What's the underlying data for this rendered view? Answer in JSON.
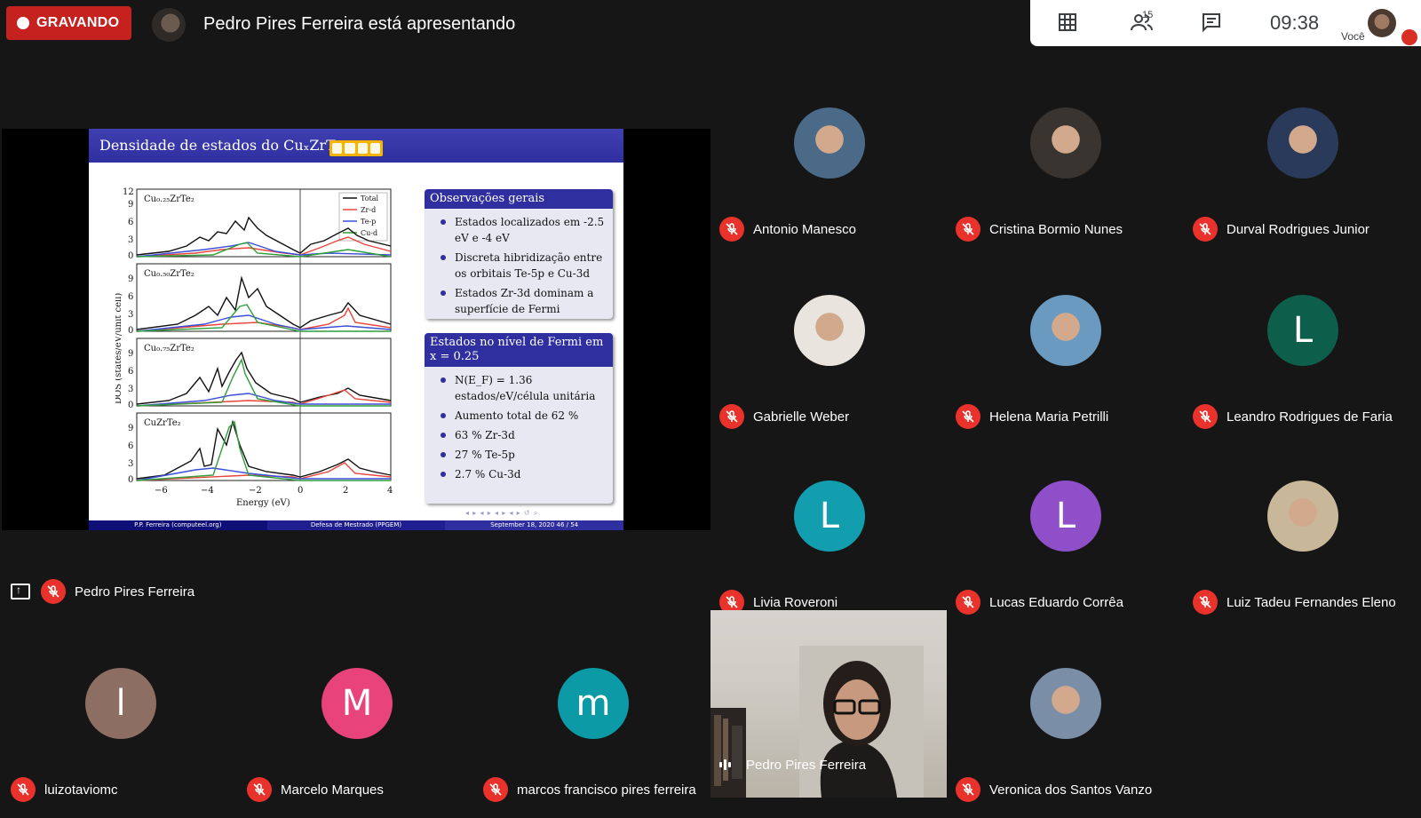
{
  "top": {
    "recording_label": "GRAVANDO",
    "presenting_text": "Pedro Pires Ferreira está apresentando",
    "participants_count": "15",
    "time": "09:38",
    "you_label": "Você"
  },
  "presentation": {
    "presenter_name": "Pedro Pires Ferreira",
    "slide_title": "Densidade de estados do CuₓZrTe₂",
    "obs_title": "Observações gerais",
    "obs_items": [
      "Estados localizados em -2.5 eV e -4 eV",
      "Discreta hibridização entre os orbitais Te-5p e Cu-3d",
      "Estados Zr-3d dominam a superfície de Fermi"
    ],
    "fermi_title": "Estados no nível de Fermi em x = 0.25",
    "fermi_items": [
      "N(E_F) = 1.36 estados/eV/célula unitária",
      "Aumento total de 62 %",
      "63 % Zr-3d",
      "27 % Te-5p",
      "2.7 % Cu-3d"
    ],
    "footer": [
      "P.P. Ferreira (computeel.org)",
      "Defesa de Mestrado (PPGEM)",
      "September 18, 2020     46 / 54"
    ],
    "plot": {
      "panels": [
        "Cu₀.₂₅ZrTe₂",
        "Cu₀.₅₀ZrTe₂",
        "Cu₀.₇₅ZrTe₂",
        "CuZrTe₂"
      ],
      "xlabel": "Energy (eV)",
      "ylabel": "DOS (states/eV/unit cell)",
      "xticks": [
        "−6",
        "−4",
        "−2",
        "0",
        "2",
        "4"
      ],
      "legend": [
        "Total",
        "Zr-d",
        "Te-p",
        "Cu-d"
      ],
      "colors": [
        "#111111",
        "#e8453c",
        "#3a4fd8",
        "#2f9e3a"
      ]
    }
  },
  "participants": [
    {
      "name": "Antonio Manesco",
      "avatar_type": "photo",
      "color": "#4a6a88"
    },
    {
      "name": "Cristina Bormio Nunes",
      "avatar_type": "photo",
      "color": "#3a3430"
    },
    {
      "name": "Durval Rodrigues Junior",
      "avatar_type": "photo",
      "color": "#2a3a5a"
    },
    {
      "name": "Gabrielle Weber",
      "avatar_type": "photo",
      "color": "#e9e4de"
    },
    {
      "name": "Helena Maria Petrilli",
      "avatar_type": "photo",
      "color": "#6a9ac0"
    },
    {
      "name": "Leandro Rodrigues de Faria",
      "avatar_type": "letter",
      "letter": "L",
      "color": "#0d5e4a"
    },
    {
      "name": "Livia Roveroni",
      "avatar_type": "letter",
      "letter": "L",
      "color": "#129eaf"
    },
    {
      "name": "Lucas Eduardo Corrêa",
      "avatar_type": "letter",
      "letter": "L",
      "color": "#8e4fc8"
    },
    {
      "name": "Luiz Tadeu Fernandes Eleno",
      "avatar_type": "photo",
      "color": "#c9b79a"
    },
    {
      "name": "luizotaviomc",
      "avatar_type": "letter",
      "letter": "l",
      "color": "#8d6e63"
    },
    {
      "name": "Marcelo Marques",
      "avatar_type": "letter",
      "letter": "M",
      "color": "#e8437a"
    },
    {
      "name": "marcos francisco pires ferreira",
      "avatar_type": "letter",
      "letter": "m",
      "color": "#0c9aa6"
    },
    {
      "name": "Pedro Pires Ferreira",
      "avatar_type": "video",
      "color": "#cfcbc4"
    },
    {
      "name": "Veronica dos Santos Vanzo",
      "avatar_type": "photo",
      "color": "#7a8ea8"
    }
  ]
}
